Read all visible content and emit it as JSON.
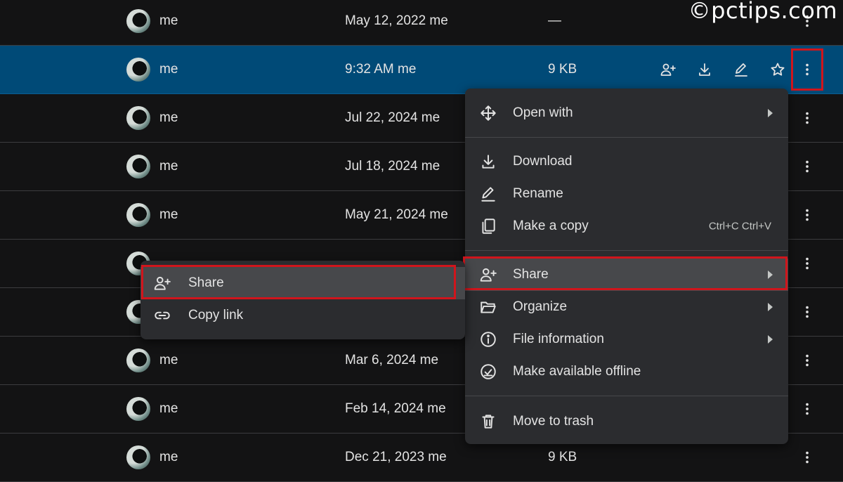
{
  "watermark": "©pctips.com",
  "rows": [
    {
      "owner": "me",
      "modified": "May 12, 2022 me",
      "size": "—"
    },
    {
      "owner": "me",
      "modified": "9:32 AM me",
      "size": "9 KB",
      "selected": true
    },
    {
      "owner": "me",
      "modified": "Jul 22, 2024 me",
      "size": ""
    },
    {
      "owner": "me",
      "modified": "Jul 18, 2024 me",
      "size": ""
    },
    {
      "owner": "me",
      "modified": "May 21, 2024 me",
      "size": ""
    },
    {
      "owner": "",
      "modified": "",
      "size": ""
    },
    {
      "owner": "",
      "modified": "",
      "size": ""
    },
    {
      "owner": "me",
      "modified": "Mar 6, 2024 me",
      "size": ""
    },
    {
      "owner": "me",
      "modified": "Feb 14, 2024 me",
      "size": ""
    },
    {
      "owner": "me",
      "modified": "Dec 21, 2023 me",
      "size": "9 KB"
    }
  ],
  "row_actions": [
    {
      "icon": "share-icon"
    },
    {
      "icon": "download-icon"
    },
    {
      "icon": "rename-icon"
    },
    {
      "icon": "star-icon"
    },
    {
      "icon": "more-vert-icon"
    }
  ],
  "context_menu": {
    "items": [
      {
        "label": "Open with",
        "icon": "move-arrows-icon",
        "submenu": true
      },
      {
        "label": "Download",
        "icon": "download-icon"
      },
      {
        "label": "Rename",
        "icon": "rename-icon"
      },
      {
        "label": "Make a copy",
        "icon": "copy-icon",
        "shortcut": "Ctrl+C Ctrl+V"
      },
      {
        "label": "Share",
        "icon": "share-icon",
        "submenu": true,
        "highlighted": true
      },
      {
        "label": "Organize",
        "icon": "folder-open-icon",
        "submenu": true
      },
      {
        "label": "File information",
        "icon": "info-icon",
        "submenu": true
      },
      {
        "label": "Make available offline",
        "icon": "offline-icon"
      },
      {
        "label": "Move to trash",
        "icon": "trash-icon"
      }
    ]
  },
  "share_submenu": {
    "items": [
      {
        "label": "Share",
        "icon": "share-icon",
        "highlighted": true
      },
      {
        "label": "Copy link",
        "icon": "link-icon"
      }
    ]
  },
  "colors": {
    "background": "#131314",
    "selected_row": "#004a77",
    "menu": "#2b2c2f",
    "highlight_border": "#d0151c"
  }
}
